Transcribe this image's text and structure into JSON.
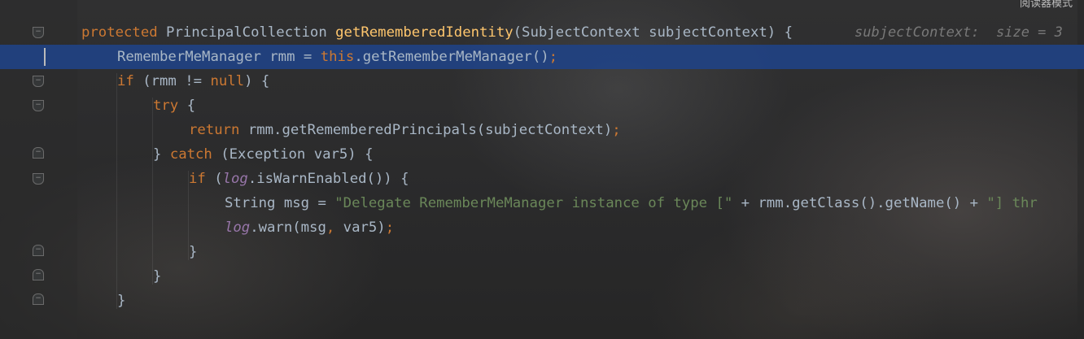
{
  "header": {
    "reader_mode_label": "阅读器模式"
  },
  "inlay_hint": "subjectContext:  size = 3",
  "code": {
    "l1": {
      "kw_protected": "protected",
      "type": "PrincipalCollection",
      "method": "getRememberedIdentity",
      "params": "(SubjectContext subjectContext) {"
    },
    "l2": {
      "decl": "RememberMeManager rmm = ",
      "kw_this": "this",
      "call": ".getRememberMeManager()",
      "semi": ";"
    },
    "l3": {
      "kw_if": "if",
      "cond_open": " (rmm != ",
      "kw_null": "null",
      "cond_close": ") {"
    },
    "l4": {
      "kw_try": "try",
      "brace": " {"
    },
    "l5": {
      "kw_return": "return",
      "expr": " rmm.getRememberedPrincipals(subjectContext)",
      "semi": ";"
    },
    "l6": {
      "brace_close": "} ",
      "kw_catch": "catch",
      "params": " (Exception var5) {"
    },
    "l7": {
      "kw_if": "if",
      "paren": " (",
      "field_log": "log",
      "call": ".isWarnEnabled()) {"
    },
    "l8": {
      "decl": "String msg = ",
      "str1": "\"Delegate RememberMeManager instance of type [\"",
      "concat": " + rmm.getClass().getName() + ",
      "str2": "\"] thr"
    },
    "l9": {
      "field_log": "log",
      "call": ".warn(msg",
      "comma": ",",
      "arg": " var5)",
      "semi": ";"
    },
    "l10": {
      "brace": "}"
    },
    "l11": {
      "brace": "}"
    },
    "l12": {
      "brace": "}"
    }
  }
}
